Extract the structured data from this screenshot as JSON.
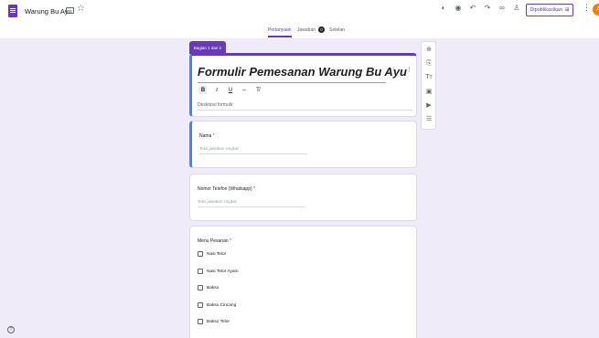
{
  "topbar": {
    "doc_title": "Warung Bu Ayu",
    "publish_label": "Dipublikasikan",
    "avatar_initial": "A"
  },
  "tabs": {
    "questions": "Pertanyaan",
    "responses": "Jawaban",
    "responses_count": "0",
    "settings": "Setelan"
  },
  "form": {
    "section_tag": "Bagian 1 dari 2",
    "title": "Formulir Pemesanan Warung Bu Ayu",
    "description_placeholder": "Deskripsi formulir",
    "format_buttons": [
      "B",
      "I",
      "U",
      "⇔",
      "T̸"
    ]
  },
  "questions": [
    {
      "label": "Nama",
      "required": "*",
      "answer_placeholder": "Teks jawaban singkat"
    },
    {
      "label": "Nomor Telefon (Whatsapp)",
      "required": "*",
      "answer_placeholder": "Teks jawaban singkat"
    },
    {
      "label": "Menu Pesanan",
      "required": "*",
      "options": [
        "Nasi Telor",
        "Nasi Telor Ayam",
        "Bakso",
        "Bakso Cincang",
        "Bakso Telor"
      ]
    }
  ],
  "side_toolbar": [
    "add-question-icon",
    "import-questions-icon",
    "add-title-icon",
    "add-image-icon",
    "add-video-icon",
    "add-section-icon"
  ],
  "colors": {
    "accent": "#673ab7",
    "active_border": "#4285f4",
    "background": "#f0ebf8"
  }
}
